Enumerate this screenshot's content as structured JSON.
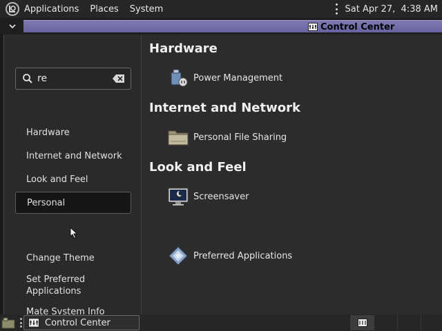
{
  "top_panel": {
    "menus": [
      "Applications",
      "Places",
      "System"
    ],
    "clock": "Sat Apr 27,  4:38 AM"
  },
  "window": {
    "title": "Control Center"
  },
  "sidebar": {
    "search_value": "re",
    "categories": [
      "Hardware",
      "Internet and Network",
      "Look and Feel",
      "Personal"
    ],
    "active_category": "Personal",
    "tasks": [
      "Change Theme",
      "Set Preferred Applications",
      "Mate System Info"
    ]
  },
  "content": {
    "sections": [
      {
        "title": "Hardware",
        "applets": [
          {
            "label": "Power Management",
            "icon": "power-management-icon"
          }
        ]
      },
      {
        "title": "Internet and Network",
        "applets": [
          {
            "label": "Personal File Sharing",
            "icon": "folder-share-icon"
          }
        ]
      },
      {
        "title": "Look and Feel",
        "applets": [
          {
            "label": "Screensaver",
            "icon": "screensaver-icon"
          }
        ]
      },
      {
        "title": "",
        "applets": [
          {
            "label": "Preferred Applications",
            "icon": "preferred-applications-icon"
          }
        ]
      }
    ]
  },
  "bottom_panel": {
    "task_label": "Control Center"
  },
  "colors": {
    "titlebar_accent": "#6f6aa8",
    "background": "#2c2c2c"
  }
}
